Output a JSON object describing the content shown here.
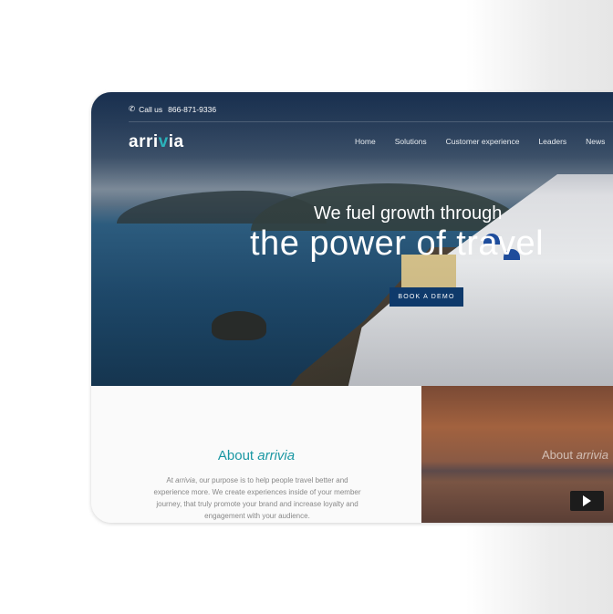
{
  "topbar": {
    "call_label": "Call us",
    "phone": "866-871-9336"
  },
  "logo": {
    "text_a": "arri",
    "text_pin": "v",
    "text_b": "ia"
  },
  "nav": {
    "items": [
      "Home",
      "Solutions",
      "Customer experience",
      "Leaders",
      "News"
    ]
  },
  "hero": {
    "line1": "We fuel growth through",
    "line2": "the power of travel",
    "cta": "BOOK A DEMO"
  },
  "about": {
    "title_plain": "About ",
    "title_brand": "arrivia",
    "body_brand": "arrivia",
    "body_prefix": "At ",
    "body": ", our purpose is to help people travel better and experience more. We create experiences inside of your member journey, that truly promote your brand and increase loyalty and engagement with your audience."
  },
  "video": {
    "title_plain": "About ",
    "title_brand": "arrivia"
  },
  "colors": {
    "brand_teal": "#1a97a3",
    "cta_navy": "#0f3a6b"
  }
}
